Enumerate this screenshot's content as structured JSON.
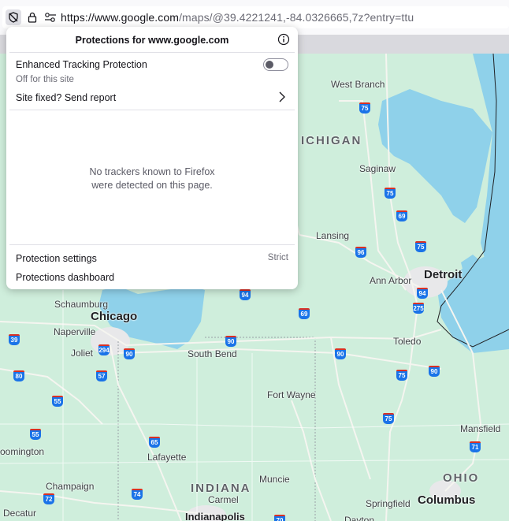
{
  "urlbar": {
    "url_host": "https://www.google.com",
    "url_rest": "/maps/@39.4221241,-84.0326665,7z?entry=ttu",
    "icons": [
      "tracking-protection-shield-icon",
      "lock-icon",
      "permissions-icon"
    ]
  },
  "panel": {
    "title": "Protections for www.google.com",
    "etp_label": "Enhanced Tracking Protection",
    "etp_enabled": false,
    "etp_status": "Off for this site",
    "report_label": "Site fixed? Send report",
    "empty_line1": "No trackers known to Firefox",
    "empty_line2": "were detected on this page.",
    "settings_label": "Protection settings",
    "settings_value": "Strict",
    "dashboard_label": "Protections dashboard"
  },
  "map": {
    "state_labels": {
      "michigan": "ICHIGAN",
      "indiana": "INDIANA",
      "ohio": "OHIO"
    },
    "cities": {
      "chicago": "Chicago",
      "detroit": "Detroit",
      "columbus": "Columbus",
      "indianapolis": "Indianapolis",
      "west_branch": "West Branch",
      "saginaw": "Saginaw",
      "lansing": "Lansing",
      "ann_arbor": "Ann Arbor",
      "schaumburg": "Schaumburg",
      "naperville": "Naperville",
      "joliet": "Joliet",
      "south_bend": "South Bend",
      "toledo": "Toledo",
      "fort_wayne": "Fort Wayne",
      "mansfield": "Mansfield",
      "lafayette": "Lafayette",
      "bloomington": "oomington",
      "champaign": "Champaign",
      "muncie": "Muncie",
      "carmel": "Carmel",
      "springfield": "Springfield",
      "decatur": "Decatur",
      "dayton": "Dayton"
    },
    "shields": {
      "i75a": "75",
      "i75b": "75",
      "i69a": "69",
      "i96": "96",
      "i75c": "75",
      "i94a": "94",
      "i275": "275",
      "i94b": "94",
      "i69b": "69",
      "i90a": "90",
      "i90b": "90",
      "i90c": "90",
      "i294": "294",
      "i90d": "90",
      "i39": "39",
      "i80": "80",
      "i57": "57",
      "i55a": "55",
      "i55b": "55",
      "i65": "65",
      "i74": "74",
      "i72": "72",
      "i75d": "75",
      "i75e": "75",
      "i71": "71",
      "i70": "70",
      "i96b": "96"
    }
  }
}
